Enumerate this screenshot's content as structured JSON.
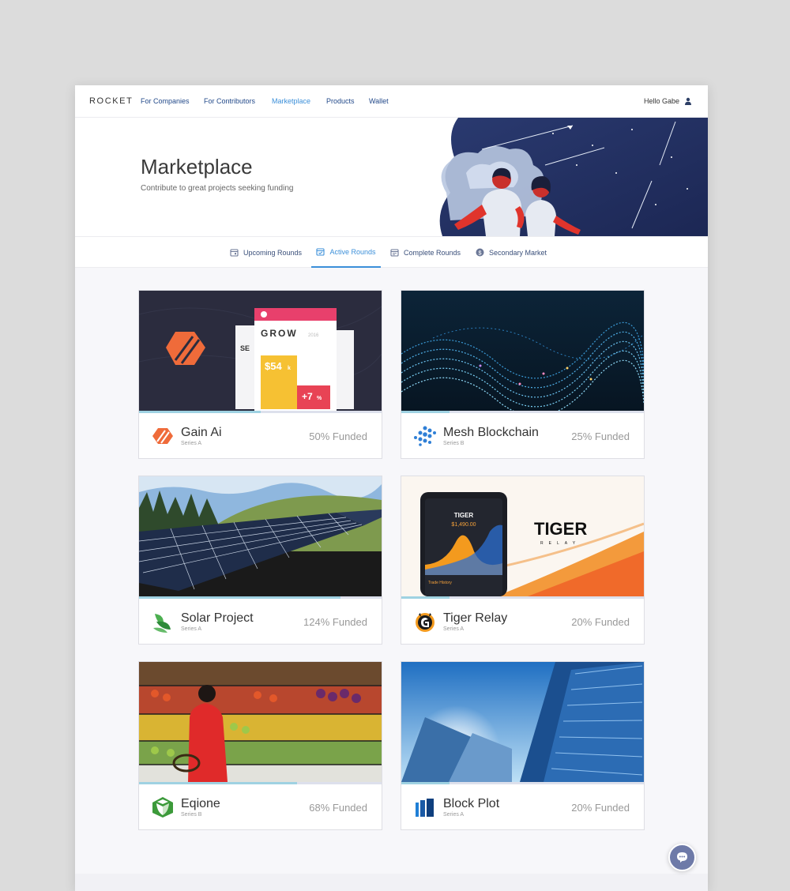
{
  "nav": {
    "brand": "ROCKET",
    "links": [
      "For Companies",
      "For Contributors",
      "Marketplace",
      "Products",
      "Wallet"
    ],
    "greeting": "Hello Gabe"
  },
  "hero": {
    "title": "Marketplace",
    "subtitle": "Contribute to great projects seeking funding"
  },
  "tabs": [
    "Upcoming Rounds",
    "Active Rounds",
    "Complete Rounds",
    "Secondary Market"
  ],
  "active_tab": "Active Rounds",
  "cards": [
    {
      "name": "Gain Ai",
      "series": "Series A",
      "funded": "50% Funded",
      "progress": 0.5
    },
    {
      "name": "Mesh Blockchain",
      "series": "Series B",
      "funded": "25% Funded",
      "progress": 0.2
    },
    {
      "name": "Solar Project",
      "series": "Series A",
      "funded": "124% Funded",
      "progress": 0.83
    },
    {
      "name": "Tiger Relay",
      "series": "Series A",
      "funded": "20% Funded",
      "progress": 0.2
    },
    {
      "name": "Eqione",
      "series": "Series B",
      "funded": "68% Funded",
      "progress": 0.65
    },
    {
      "name": "Block Plot",
      "series": "Series A",
      "funded": "20% Funded",
      "progress": 0.2
    }
  ],
  "card_images": {
    "gain": {
      "grow": "GROW",
      "year": "2016",
      "amount": "$54",
      "amount_suffix": "k",
      "growth": "+7",
      "growth_suffix": "%",
      "side": "SE"
    },
    "tiger": {
      "phone_brand": "TIGER",
      "balance": "$1,490.00",
      "logo": "TIGER",
      "logo_sub": "RELAY",
      "trade": "Trade History"
    }
  },
  "colors": {
    "accent": "#3b8fd9",
    "nav_link": "#234a8a",
    "progress": "#9fd2e2",
    "chat": "#6e7aa8"
  },
  "icons": {
    "user": "user-icon",
    "tab": "calendar-icon",
    "secondary": "dollar-coin-icon",
    "chat": "chat-bubble-icon"
  }
}
